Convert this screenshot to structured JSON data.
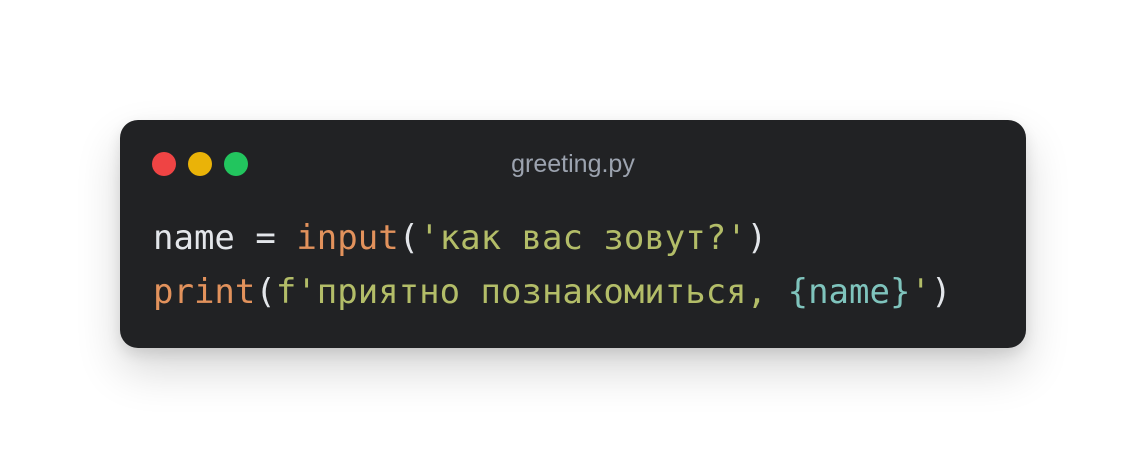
{
  "window": {
    "title": "greeting.py",
    "traffic_lights": {
      "close": "#ef4444",
      "minimize": "#eab308",
      "maximize": "#22c55e"
    }
  },
  "code": {
    "line1": {
      "var": "name",
      "assign": " = ",
      "fn": "input",
      "open_paren": "(",
      "string": "'как вас зовут?'",
      "close_paren": ")"
    },
    "line2": {
      "fn": "print",
      "open_paren": "(",
      "string_prefix": "f'приятно познакомиться, ",
      "interp_open": "{",
      "interp_var": "name",
      "interp_close": "}",
      "string_suffix": "'",
      "close_paren": ")"
    }
  },
  "colors": {
    "background": "#212224",
    "function": "#e2925c",
    "string": "#b3bd68",
    "interpolation": "#7fc4bd",
    "text": "#e3e6ea",
    "title": "#9ca3af"
  }
}
